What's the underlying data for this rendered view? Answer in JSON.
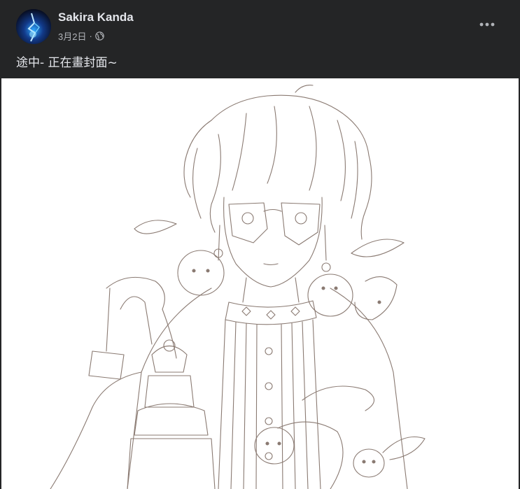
{
  "post": {
    "author": "Sakira Kanda",
    "date": "3月2日",
    "separator": "·",
    "audience_icon": "globe-icon",
    "caption": "途中- 正在畫封面~",
    "more_icon": "more-options-icon"
  },
  "colors": {
    "background": "#242526",
    "primary_text": "#e4e6eb",
    "secondary_text": "#b0b3b8",
    "sketch_line": "#8a7a72"
  }
}
